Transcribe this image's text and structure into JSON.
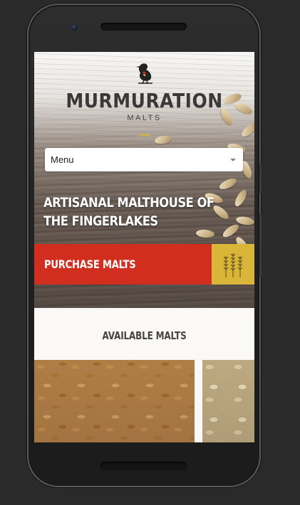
{
  "brand": {
    "name": "MURMURATION",
    "sub": "MALTS",
    "logo_icon": "blackbird-logo-icon"
  },
  "nav": {
    "menu_label": "Menu",
    "caret_icon": "chevron-down-icon"
  },
  "hero": {
    "tagline": "ARTISANAL MALTHOUSE OF THE FINGERLAKES",
    "purchase_label": "PURCHASE MALTS",
    "purchase_icon": "wheat-icon"
  },
  "section": {
    "title": "AVAILABLE MALTS",
    "cards": [
      "malt-image-1",
      "malt-image-2"
    ]
  },
  "colors": {
    "accent_red": "#d12e1f",
    "accent_gold": "#d9b637",
    "text_dark": "#3a3838"
  }
}
